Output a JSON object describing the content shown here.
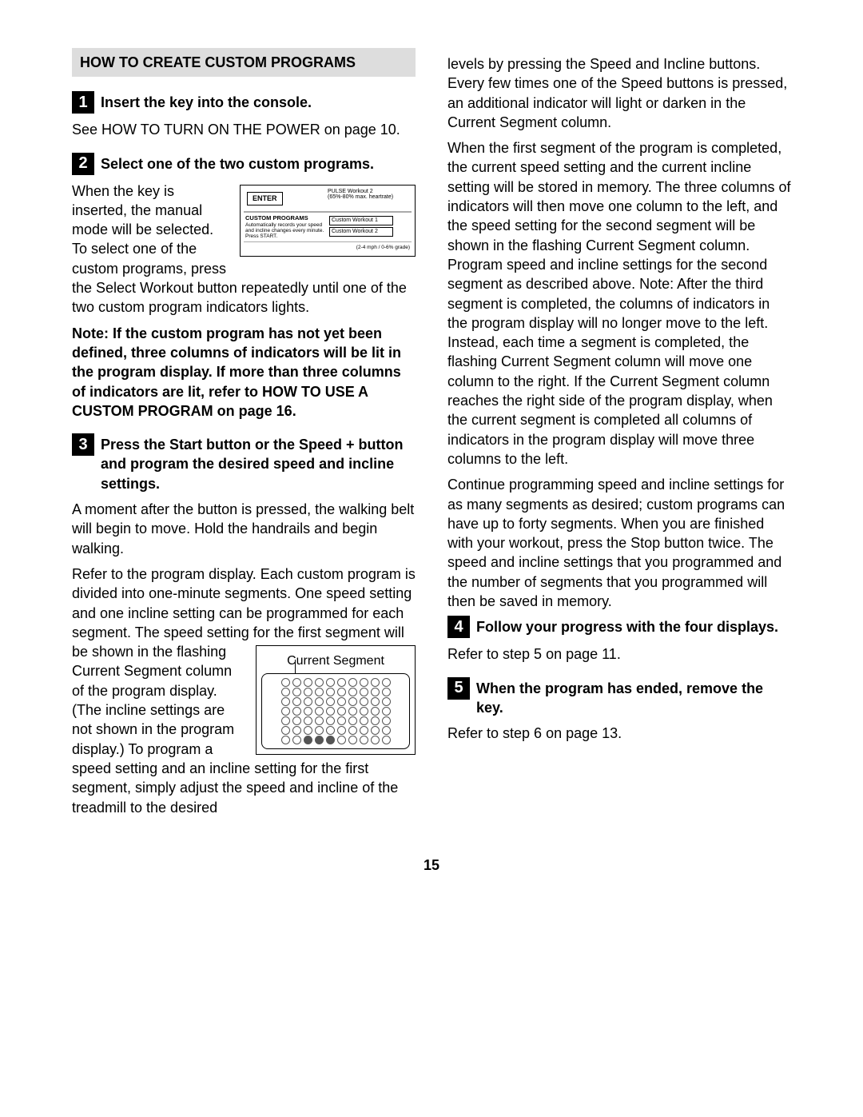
{
  "header": "HOW TO CREATE CUSTOM PROGRAMS",
  "steps": {
    "s1": {
      "num": "1",
      "title": "Insert the key into the console.",
      "p1": "See HOW TO TURN ON THE POWER on page 10."
    },
    "s2": {
      "num": "2",
      "title": "Select one of the two custom programs.",
      "p1a": "When the key is inserted, the manual mode will be selected. To select one of the custom programs, press",
      "p1b": "the Select Workout button repeatedly until one of the two custom program indicators lights.",
      "note": "Note: If the custom program has not yet been defined, three columns of indicators will be lit in the program display. If more than three columns of indicators are lit, refer to HOW TO USE A CUSTOM PROGRAM on page 16."
    },
    "s3": {
      "num": "3",
      "title": "Press the Start button or the Speed + button and program the desired speed and incline settings.",
      "p1": "A moment after the button is pressed, the walking belt will begin to move. Hold the handrails and begin walking.",
      "p2a": "Refer to the program display. Each custom program is divided into one-minute segments. One speed setting and one incline setting can be programmed for each segment. The speed setting for",
      "p2b": "the first segment will be shown in the flashing Current Segment column of the program display. (The incline settings are not shown in the program display.) To program a speed setting and an incline",
      "p2c": "setting for the first segment, simply adjust the speed and incline of the treadmill to the desired",
      "p3": "levels by pressing the Speed and Incline buttons. Every few times one of the Speed buttons is pressed, an additional indicator will light or darken in the Current Segment column.",
      "p4": "When the first segment of the program is completed, the current speed setting and the current incline setting will be stored in memory. The three columns of indicators will then move one column to the left, and the speed setting for the second segment will be shown in the flashing Current Segment column. Program speed and incline settings for the second segment as described above. Note: After the third segment is completed, the columns of indicators in the program display will no longer move to the left. Instead, each time a segment is completed, the flashing Current Segment column will move one column to the right. If the Current Segment column reaches the right side of the program display, when the current segment is completed all columns of indicators in the program display will move three columns to the left.",
      "p5": "Continue programming speed and incline settings for as many segments as desired; custom programs can have up to forty segments. When you are finished with your workout, press the Stop button twice. The speed and incline settings that you programmed and the number of segments that you programmed will then be saved in memory."
    },
    "s4": {
      "num": "4",
      "title": "Follow your progress with the four displays.",
      "p1": "Refer to step 5 on page 11."
    },
    "s5": {
      "num": "5",
      "title": "When the program has ended, remove the key.",
      "p1": "Refer to step 6 on page 13."
    }
  },
  "fig1": {
    "enter": "ENTER",
    "pulse": "PULSE Workout 2",
    "pulse_sub": "(65%-80% max. heartrate)",
    "custom_hdr": "CUSTOM PROGRAMS",
    "custom_desc": "Automatically records your speed and incline changes every minute. Press START.",
    "cw1": "Custom Workout 1",
    "cw2": "Custom Workout 2",
    "bottom": "(2-4 mph / 0-6% grade)"
  },
  "fig2": {
    "title": "Current Segment"
  },
  "page_number": "15"
}
